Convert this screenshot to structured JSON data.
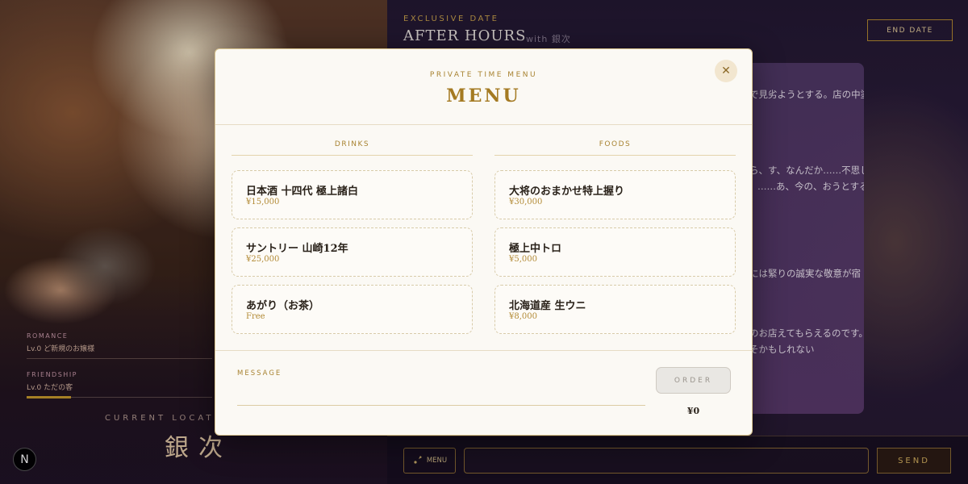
{
  "stats": [
    {
      "label": "ROMANCE",
      "value": "Lv.0 ど新規のお嬢様",
      "level": 0,
      "accent": "#c79a2a"
    },
    {
      "label": "FRIENDSHIP",
      "value": "Lv.0 ただの客",
      "level": 0.24,
      "accent": "#c79a2a"
    }
  ],
  "location": {
    "caption": "CURRENT LOCATION",
    "name": "銀次"
  },
  "badge": {
    "letter": "N"
  },
  "header": {
    "label": "EXCLUSIVE DATE",
    "title": "AFTER HOURS",
    "with": "with 銀次",
    "end_date_label": "END DATE"
  },
  "story": [
    "服が貴女の隣で見劣ようとする。店の中塗り替えられてい",
    "店が終わったら、す、なんだか……不思しれないですけす。……あ、今の、おうとすると、すぐ",
    "見つめる。瞳には緊りの誠実な敬意が宿",
    "嬢様の馴染みのお店えてもらえるのです。……行きまし手くそかもしれない"
  ],
  "bottom_bar": {
    "menu_label": "MENU",
    "input_value": "",
    "send_label": "SEND"
  },
  "modal": {
    "subtitle": "PRIVATE TIME MENU",
    "title": "MENU",
    "close_icon": "close-icon",
    "drinks": {
      "heading": "DRINKS",
      "items": [
        {
          "name": "日本酒 十四代 極上諸白",
          "price": "¥15,000"
        },
        {
          "name": "サントリー 山崎12年",
          "price": "¥25,000"
        },
        {
          "name": "あがり（お茶）",
          "price": "Free"
        }
      ]
    },
    "foods": {
      "heading": "FOODS",
      "items": [
        {
          "name": "大将のおまかせ特上握り",
          "price": "¥30,000"
        },
        {
          "name": "極上中トロ",
          "price": "¥5,000"
        },
        {
          "name": "北海道産 生ウニ",
          "price": "¥8,000"
        }
      ]
    },
    "message_label": "MESSAGE",
    "message_value": "",
    "order_label": "ORDER",
    "total": "¥0"
  }
}
